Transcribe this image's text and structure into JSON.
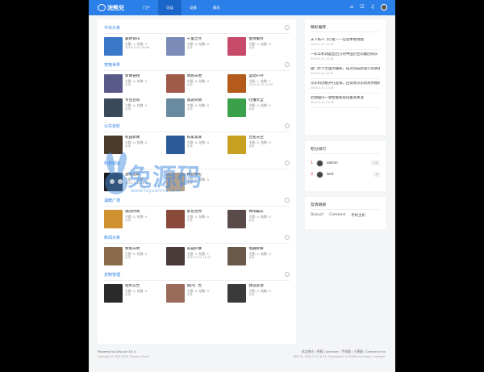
{
  "header": {
    "logo_text": "浣熊兒",
    "nav": [
      "门户",
      "论坛",
      "设备",
      "群乐"
    ],
    "active_nav": 1
  },
  "sections": [
    {
      "title": "今日头条",
      "rows": [
        [
          {
            "name": "最新资讯",
            "meta": "主题: 1, 帖数: 1",
            "last": "2019-3-14 18:46",
            "color": "#3a78c9"
          },
          {
            "name": "千里之外",
            "meta": "主题: 0, 帖数: 0",
            "last": "从未",
            "color": "#7a8bb8"
          },
          {
            "name": "金牌服务",
            "meta": "主题: 0, 帖数: 0",
            "last": "从未",
            "color": "#c84a6a"
          }
        ]
      ]
    },
    {
      "title": "宠物世界",
      "rows": [
        [
          {
            "name": "新闻链接",
            "meta": "主题: 0, 帖数: 0",
            "last": "从未",
            "color": "#5a5a8a"
          },
          {
            "name": "情感天地",
            "meta": "主题: 0, 帖数: 0",
            "last": "从未",
            "color": "#a05a4a"
          },
          {
            "name": "运动户外",
            "meta": "主题: 1, 帖数: 1",
            "last": "2019-3-14 12:05",
            "color": "#b45a1a"
          }
        ],
        [
          {
            "name": "专业咨询",
            "meta": "主题: 0, 帖数: 0",
            "last": "从未",
            "color": "#3a4a5a"
          },
          {
            "name": "旅游风情",
            "meta": "主题: 0, 帖数: 0",
            "last": "从未",
            "color": "#6a8aa0"
          },
          {
            "name": "吐槽大全",
            "meta": "主题: 0, 帖数: 0",
            "last": "从未",
            "color": "#3aa04a"
          }
        ]
      ]
    },
    {
      "title": "公共资料",
      "rows": [
        [
          {
            "name": "校园新闻",
            "meta": "主题: 0, 帖数: 0",
            "last": "从未",
            "color": "#4a3a2a"
          },
          {
            "name": "私家美食",
            "meta": "主题: 0, 帖数: 0",
            "last": "从未",
            "color": "#2a5a9a"
          },
          {
            "name": "百变天空",
            "meta": "主题: 0, 帖数: 0",
            "last": "从未",
            "color": "#c8a020"
          }
        ]
      ]
    },
    {
      "title": "科普频道",
      "rows": [
        [
          {
            "name": "战争追踪",
            "meta": "主题: 1, 帖数: 1",
            "last": "2019-3-14 18:01",
            "color": "#1a1a1a"
          },
          {
            "name": "舞会精彩",
            "meta": "主题: 0, 帖数: 0",
            "last": "从未",
            "color": "#b0a090"
          },
          {
            "name": "",
            "meta": "",
            "last": "",
            "color": "#ffffff"
          }
        ]
      ]
    },
    {
      "title": "温暖广场",
      "rows": [
        [
          {
            "name": "潮流时尚",
            "meta": "主题: 0, 帖数: 0",
            "last": "从未",
            "color": "#d09030"
          },
          {
            "name": "影音世界",
            "meta": "主题: 0, 帖数: 0",
            "last": "从未",
            "color": "#8a4a3a"
          },
          {
            "name": "休闲娱乐",
            "meta": "主题: 0, 帖数: 0",
            "last": "从未",
            "color": "#5a4a4a"
          }
        ]
      ]
    },
    {
      "title": "新闻头条",
      "rows": [
        [
          {
            "name": "情感天地",
            "meta": "主题: 0, 帖数: 0",
            "last": "从未",
            "color": "#8a6a4a"
          },
          {
            "name": "美容护肤",
            "meta": "主题: 1, 帖数: 1",
            "last": "2019-3-14 13:17",
            "color": "#4a3a3a"
          },
          {
            "name": "电器拆解",
            "meta": "主题: 0, 帖数: 0",
            "last": "从未",
            "color": "#6a5a4a"
          }
        ]
      ]
    },
    {
      "title": "定制管理",
      "rows": [
        [
          {
            "name": "站务公告",
            "meta": "主题: 0, 帖数: 0",
            "last": "从未",
            "color": "#2a2a2a"
          },
          {
            "name": "站内广告",
            "meta": "主题: 0, 帖数: 0",
            "last": "从未",
            "color": "#9a6a5a"
          },
          {
            "name": "建议反馈",
            "meta": "主题: 0, 帖数: 0",
            "last": "从未",
            "color": "#3a3a3a"
          }
        ]
      ]
    }
  ],
  "sidebar": {
    "articles_title": "精彩推荐",
    "articles": [
      {
        "title": "天下私人飞行者——信息本地用图",
        "date": "2019-3-14 13:16"
      },
      {
        "title": "一年年利润超出百万的中国企业的集团风头",
        "date": "2019-3-14 13:16"
      },
      {
        "title": "厦门大学全国为通知，成功完成新发行的调查",
        "date": "2019-3-14 13:16"
      },
      {
        "title": "京东科创板开打起来，还得到京东的商务模式",
        "date": "2019-3-14 13:16"
      },
      {
        "title": "近期国内一款智能家居设备受关注",
        "date": "2019-3-14 13:16"
      }
    ],
    "rank_title": "积分排行",
    "ranks": [
      {
        "no": "1",
        "name": "admin",
        "count": "10"
      },
      {
        "no": "2",
        "name": "test",
        "count": "0"
      }
    ],
    "links_title": "友情链接",
    "links": [
      "Discuz!",
      "Comsenz",
      "手机主机"
    ]
  },
  "footer": {
    "left1": "Powered by Discuz! X3.4",
    "left2": "Copyright © 2001-2020, Tencent Cloud.",
    "right1": "站点统计 | 举报 | Archiver | 手机版 | 小黑屋 | Comsenz Inc.",
    "right2": "GMT+8, 2020-1-31 10:11 , Processed in 0.034601 second(s), 5 queries ."
  },
  "watermark": {
    "text": "兔源码",
    "url": "www.tuyuanma.com"
  }
}
